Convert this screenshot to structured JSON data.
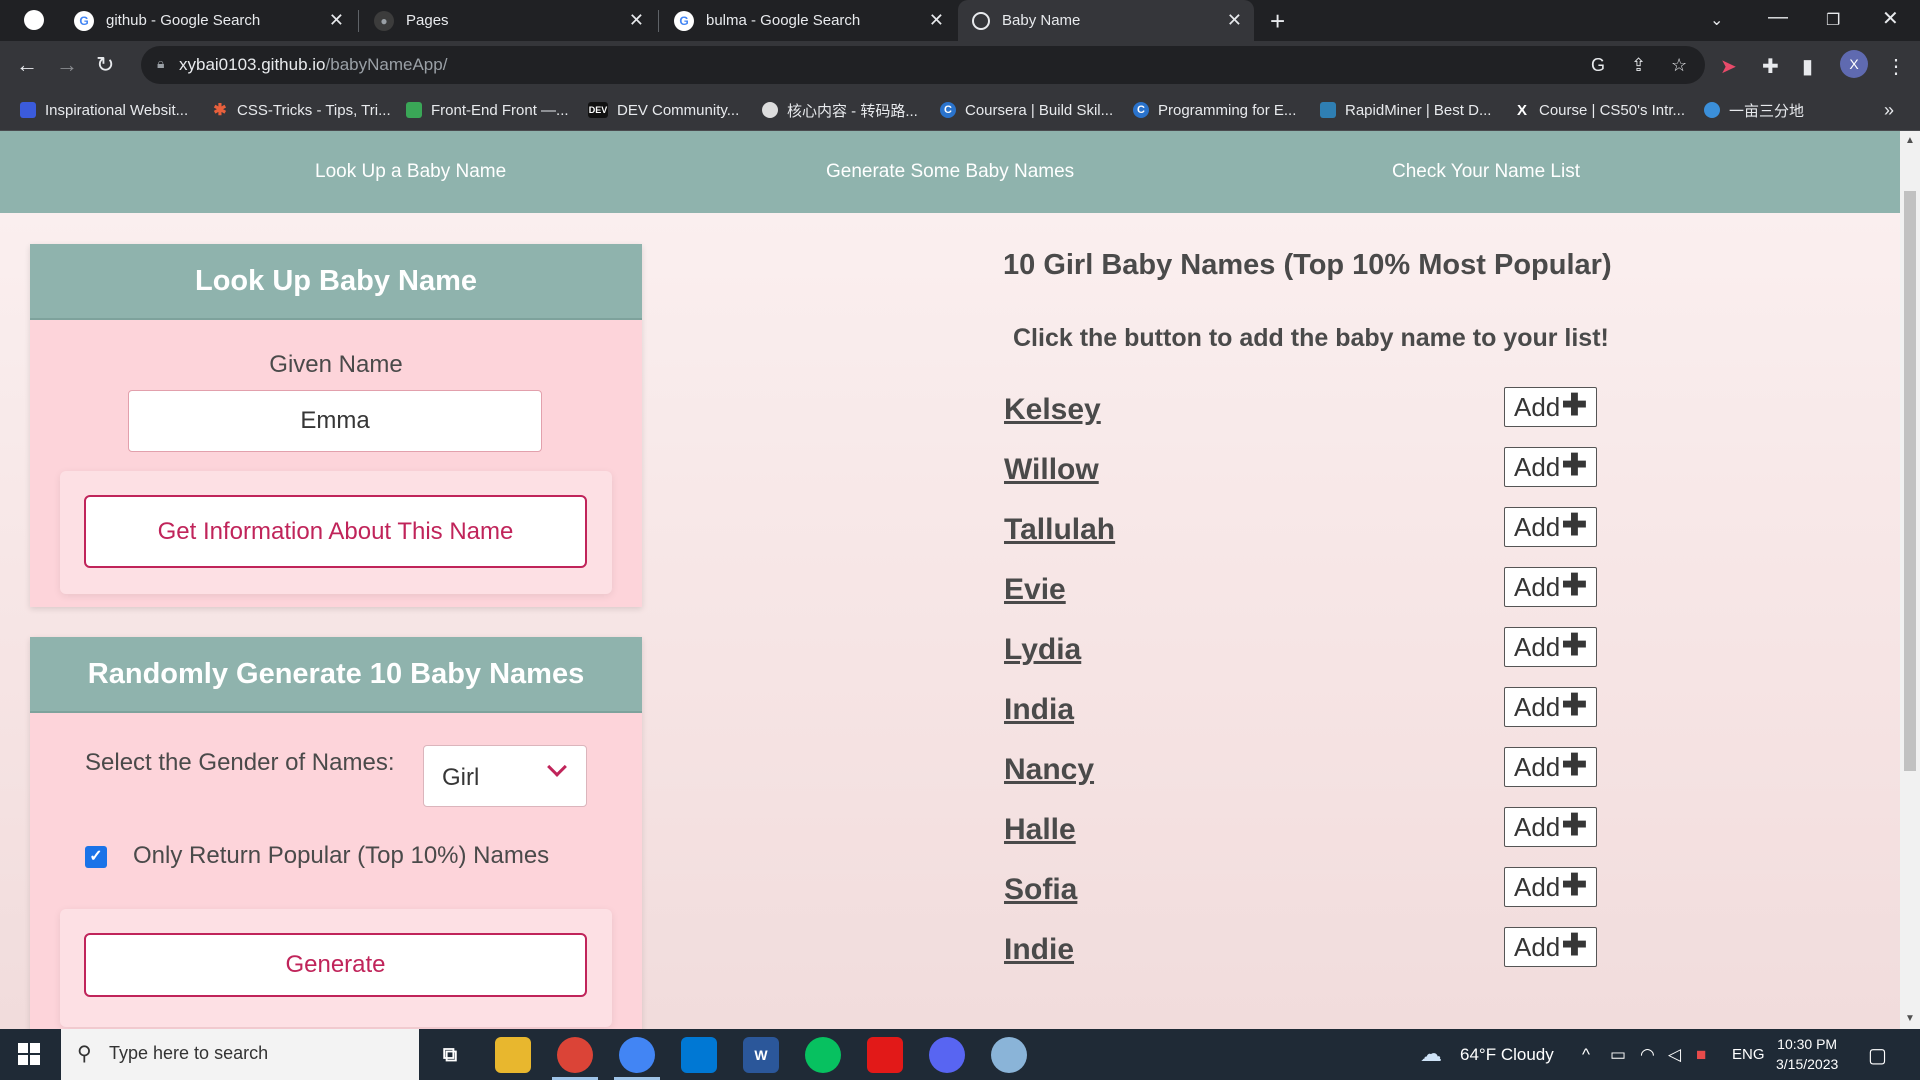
{
  "browser": {
    "tabs": [
      {
        "title": "github - Google Search",
        "icon": "google-icon"
      },
      {
        "title": "Pages",
        "icon": "github-icon"
      },
      {
        "title": "bulma - Google Search",
        "icon": "google-icon"
      },
      {
        "title": "Baby Name",
        "icon": "globe-icon",
        "active": true
      }
    ],
    "url_host": "xybai0103.github.io",
    "url_path": "/babyNameApp/",
    "profile_initial": "X",
    "bookmarks": [
      "Inspirational Websit...",
      "CSS-Tricks - Tips, Tri...",
      "Front-End Front —...",
      "DEV Community...",
      "核心内容 - 转码路...",
      "Coursera | Build Skil...",
      "Programming for E...",
      "RapidMiner | Best D...",
      "Course | CS50's Intr...",
      "一亩三分地"
    ],
    "dev_badge": "DEV",
    "bookmarks_more": "»"
  },
  "site_nav": {
    "lookup": "Look Up a Baby Name",
    "generate": "Generate Some Baby Names",
    "list": "Check Your Name List"
  },
  "lookup_card": {
    "title": "Look Up Baby Name",
    "field_label": "Given Name",
    "field_value": "Emma",
    "button": "Get Information About This Name"
  },
  "generate_card": {
    "title": "Randomly Generate 10 Baby Names",
    "gender_label": "Select the Gender of Names:",
    "gender_value": "Girl",
    "popular_label": "Only Return Popular (Top 10%) Names",
    "popular_checked": true,
    "button": "Generate"
  },
  "results": {
    "title": "10 Girl Baby Names (Top 10% Most Popular)",
    "subtitle": "Click the button to add the baby name to your list!",
    "add_label": "Add",
    "add_symbol": "✚",
    "names": [
      "Kelsey",
      "Willow",
      "Tallulah",
      "Evie",
      "Lydia",
      "India",
      "Nancy",
      "Halle",
      "Sofia",
      "Indie"
    ]
  },
  "taskbar": {
    "search_placeholder": "Type here to search",
    "weather": "64°F  Cloudy",
    "language": "ENG",
    "time": "10:30 PM",
    "date": "3/15/2023"
  },
  "colors": {
    "teal": "#8fb3ad",
    "card_pink": "#fdd4da",
    "button_accent": "#c0245a",
    "checkbox_blue": "#1a73e8"
  }
}
